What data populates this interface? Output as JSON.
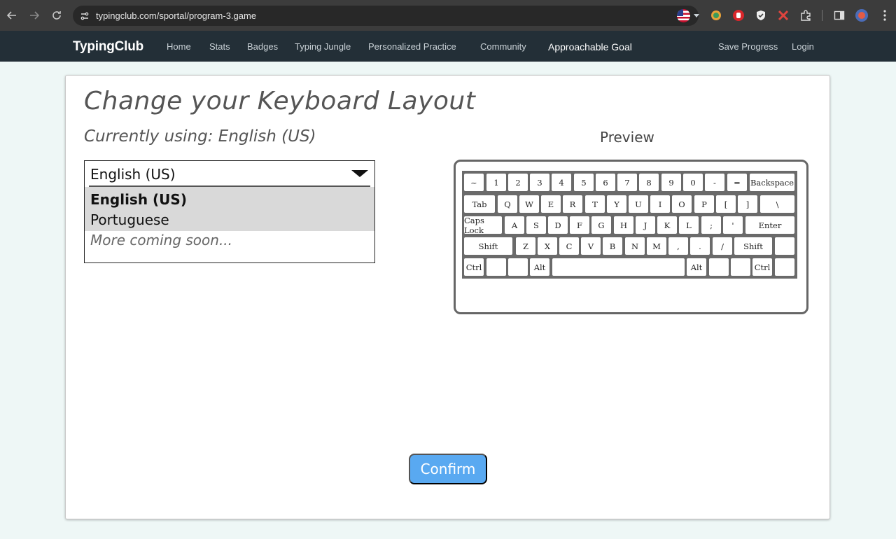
{
  "browser": {
    "url": "typingclub.com/sportal/program-3.game"
  },
  "nav": {
    "brand": "TypingClub",
    "links": [
      "Home",
      "Stats",
      "Badges",
      "Typing Jungle",
      "Personalized Practice",
      "Community"
    ],
    "goal": "Approachable Goal",
    "save": "Save Progress",
    "login": "Login"
  },
  "page": {
    "title": "Change your Keyboard Layout",
    "current": "Currently using: English (US)",
    "preview_label": "Preview",
    "confirm": "Confirm"
  },
  "dropdown": {
    "selected": "English (US)",
    "options": [
      "English (US)",
      "Portuguese"
    ],
    "more": "More coming soon..."
  },
  "keyboard": {
    "row1": [
      "~",
      "1",
      "2",
      "3",
      "4",
      "5",
      "6",
      "7",
      "8",
      "9",
      "0",
      "-",
      "=",
      "Backspace"
    ],
    "row2": [
      "Tab",
      "Q",
      "W",
      "E",
      "R",
      "T",
      "Y",
      "U",
      "I",
      "O",
      "P",
      "[",
      "]",
      "\\"
    ],
    "row3": [
      "Caps Lock",
      "A",
      "S",
      "D",
      "F",
      "G",
      "H",
      "J",
      "K",
      "L",
      ";",
      "'",
      "Enter"
    ],
    "row4": [
      "Shift",
      "Z",
      "X",
      "C",
      "V",
      "B",
      "N",
      "M",
      ",",
      ".",
      "/",
      "Shift",
      ""
    ],
    "row5": [
      "Ctrl",
      "",
      "",
      "Alt",
      "",
      "Alt",
      "",
      "",
      "Ctrl",
      ""
    ]
  },
  "colors": {
    "nav_bg": "#232f37",
    "confirm_bg": "#59a9f1",
    "page_bg": "#eef7f6"
  }
}
